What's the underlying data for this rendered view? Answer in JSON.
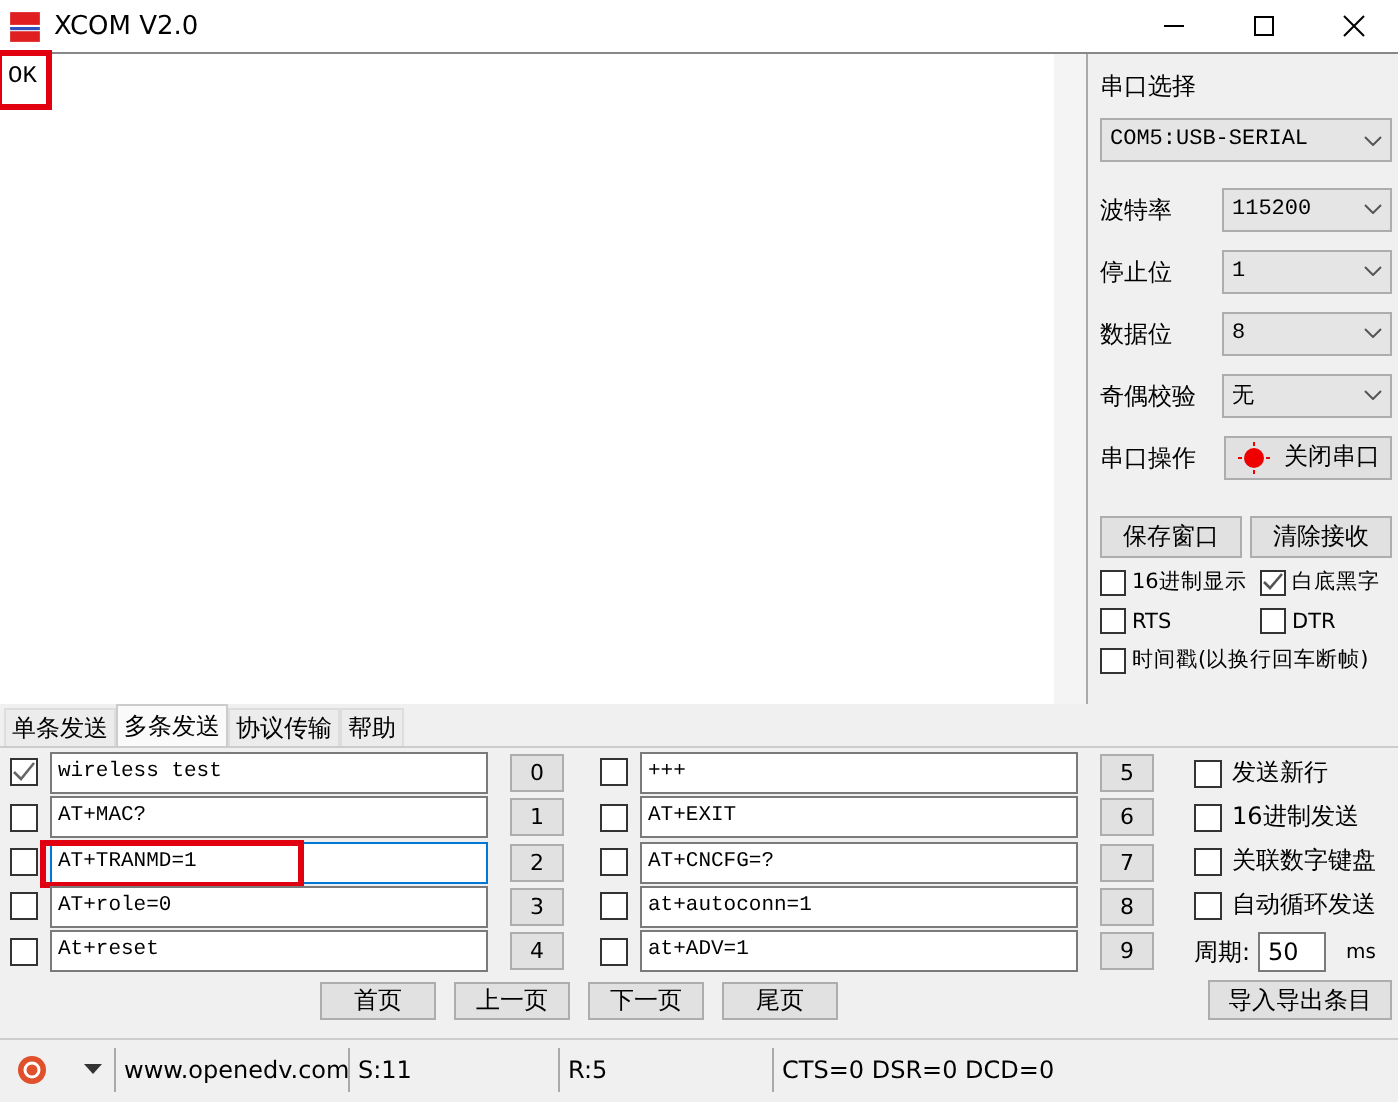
{
  "window": {
    "title": "XCOM V2.0"
  },
  "receive": {
    "text": "OK",
    "highlighted": true
  },
  "settings": {
    "port_label": "串口选择",
    "port": "COM5:USB-SERIAL",
    "fields": [
      {
        "label": "波特率",
        "value": "115200"
      },
      {
        "label": "停止位",
        "value": "1"
      },
      {
        "label": "数据位",
        "value": "8"
      },
      {
        "label": "奇偶校验",
        "value": "无"
      }
    ],
    "operate_label": "串口操作",
    "operate_button": "关闭串口",
    "port_open": true,
    "buttons": [
      "保存窗口",
      "清除接收"
    ],
    "options": [
      {
        "label": "16进制显示",
        "checked": false
      },
      {
        "label": "白底黑字",
        "checked": true
      },
      {
        "label": "RTS",
        "checked": false
      },
      {
        "label": "DTR",
        "checked": false
      },
      {
        "label": "时间戳(以换行回车断帧)",
        "checked": false
      }
    ]
  },
  "tabs": [
    {
      "label": "单条发送",
      "selected": false
    },
    {
      "label": "多条发送",
      "selected": true
    },
    {
      "label": "协议传输",
      "selected": false
    },
    {
      "label": "帮助",
      "selected": false
    }
  ],
  "send_rows": [
    {
      "checked": true,
      "text": "wireless test",
      "button": "0",
      "focused": false,
      "highlighted": false
    },
    {
      "checked": false,
      "text": "AT+MAC?",
      "button": "1",
      "focused": false,
      "highlighted": false
    },
    {
      "checked": false,
      "text": "AT+TRANMD=1",
      "button": "2",
      "focused": true,
      "highlighted": true
    },
    {
      "checked": false,
      "text": "AT+role=0",
      "button": "3",
      "focused": false,
      "highlighted": false
    },
    {
      "checked": false,
      "text": "At+reset",
      "button": "4",
      "focused": false,
      "highlighted": false
    },
    {
      "checked": false,
      "text": "+++",
      "button": "5",
      "focused": false,
      "highlighted": false
    },
    {
      "checked": false,
      "text": "AT+EXIT",
      "button": "6",
      "focused": false,
      "highlighted": false
    },
    {
      "checked": false,
      "text": "AT+CNCFG=?",
      "button": "7",
      "focused": false,
      "highlighted": false
    },
    {
      "checked": false,
      "text": "at+autoconn=1",
      "button": "8",
      "focused": false,
      "highlighted": false
    },
    {
      "checked": false,
      "text": "at+ADV=1",
      "button": "9",
      "focused": false,
      "highlighted": false
    }
  ],
  "nav_buttons": [
    "首页",
    "上一页",
    "下一页",
    "尾页"
  ],
  "send_options": [
    {
      "label": "发送新行",
      "checked": false
    },
    {
      "label": "16进制发送",
      "checked": false
    },
    {
      "label": "关联数字键盘",
      "checked": false
    },
    {
      "label": "自动循环发送",
      "checked": false
    }
  ],
  "period": {
    "label": "周期:",
    "value": "50",
    "unit": "ms"
  },
  "import_button": "导入导出条目",
  "status_bar": {
    "website": "www.openedv.com",
    "sent": "S:11",
    "received": "R:5",
    "lines": "CTS=0 DSR=0 DCD=0"
  }
}
